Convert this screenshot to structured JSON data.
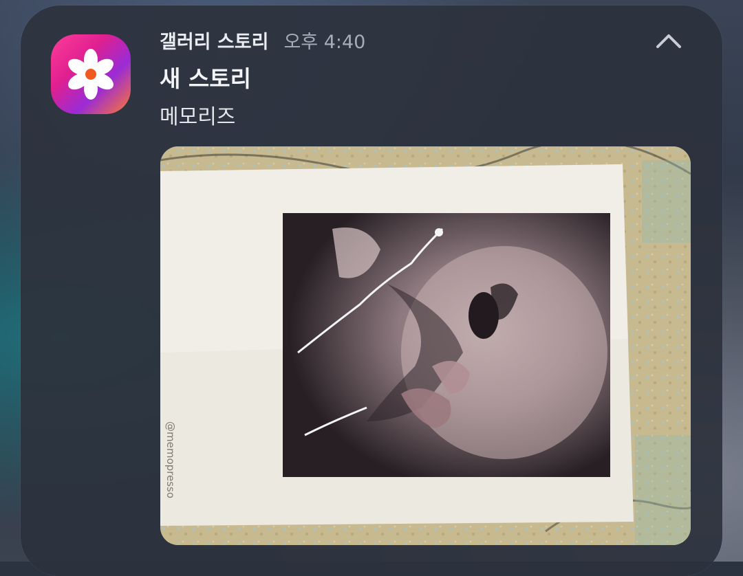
{
  "notification": {
    "app_name": "갤러리 스토리",
    "time": "오후 4:40",
    "title": "새 스토리",
    "subtitle": "메모리즈",
    "icons": {
      "app": "gallery-flower-icon",
      "collapse": "chevron-up-icon"
    },
    "preview": {
      "watermark": "@memopresso"
    }
  },
  "colors": {
    "card_bg": "#2c323d",
    "text_primary": "#f2f4f7",
    "text_secondary": "#a7adb8",
    "app_icon_gradient": [
      "#ff3d9a",
      "#9a2bd6",
      "#ff7a2e"
    ]
  }
}
